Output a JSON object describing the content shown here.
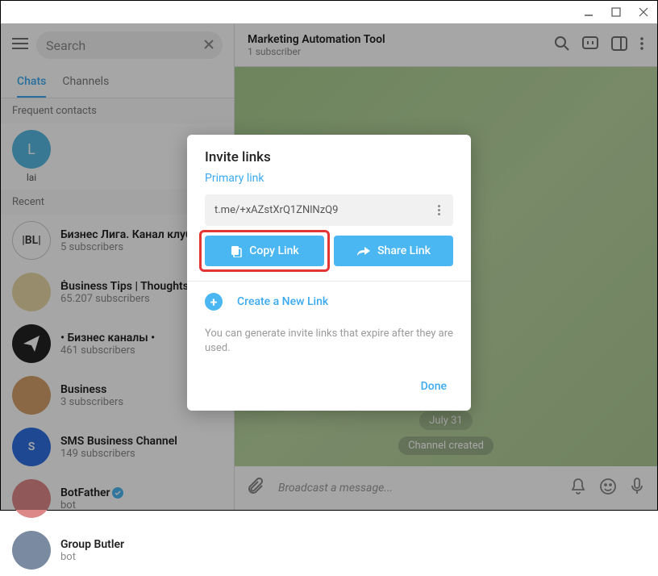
{
  "window": {
    "minimize": "—",
    "maximize": "□",
    "close": "✕"
  },
  "sidebar": {
    "search_placeholder": "Search",
    "tabs": {
      "chats": "Chats",
      "channels": "Channels"
    },
    "frequent_label": "Frequent contacts",
    "frequent": [
      {
        "initial": "L",
        "name": "lai",
        "color": "#57b8e0"
      }
    ],
    "recent_label": "Recent",
    "chats": [
      {
        "title": "Бизнес Лига. Канал клуба",
        "sub": "5 subscribers",
        "avatar_bg": "#ffffff",
        "avatar_text": "|BL|",
        "avatar_text_color": "#333",
        "avatar_border": "1px solid #ccc"
      },
      {
        "title": "Ḃusiness Tips | Thoughts",
        "sub": "65.207 subscribers",
        "avatar_bg": "#e8d9a8"
      },
      {
        "title": "• Бизнес каналы •",
        "sub": "461 subscribers",
        "avatar_bg": "#222",
        "avatar_icon": "plane"
      },
      {
        "title": "Business",
        "sub": "3 subscribers",
        "avatar_bg": "#d4a06a"
      },
      {
        "title": "SMS Business Channel",
        "sub": "149 subscribers",
        "avatar_bg": "#2f6fe0",
        "avatar_text": "S",
        "avatar_text_color": "#fff"
      },
      {
        "title": "BotFather",
        "sub": "bot",
        "avatar_bg": "#d88",
        "verified": true
      },
      {
        "title": "Group Butler",
        "sub": "bot",
        "avatar_bg": "#7a8aa0"
      }
    ]
  },
  "main": {
    "title": "Marketing Automation Tool",
    "subtitle": "1 subscriber",
    "date_pill": "July 31",
    "created_pill": "Channel created",
    "composer_placeholder": "Broadcast a message..."
  },
  "modal": {
    "title": "Invite links",
    "primary_label": "Primary link",
    "link_value": "t.me/+xAZstXrQ1ZNlNzQ9",
    "copy_label": "Copy Link",
    "share_label": "Share Link",
    "create_label": "Create a New Link",
    "help_text": "You can generate invite links that expire after they are used.",
    "done_label": "Done"
  }
}
